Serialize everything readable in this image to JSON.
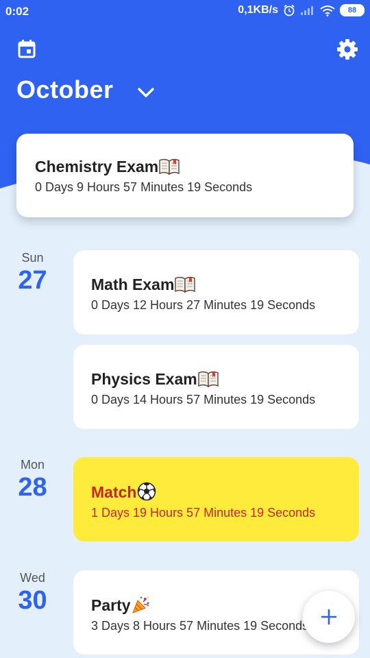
{
  "status_bar": {
    "time": "0:02",
    "net_speed": "0,1KB/s",
    "battery": "88"
  },
  "header": {
    "month": "October"
  },
  "featured": {
    "title": "Chemistry Exam",
    "emoji": "book-icon",
    "countdown": "0 Days 9 Hours 57 Minutes 19 Seconds"
  },
  "days": [
    {
      "dow": "Sun",
      "day": "27"
    },
    {
      "dow": "Mon",
      "day": "28"
    },
    {
      "dow": "Wed",
      "day": "30"
    }
  ],
  "events": [
    {
      "title": "Math Exam",
      "emoji": "book-icon",
      "countdown": "0 Days 12 Hours 27 Minutes 19 Seconds"
    },
    {
      "title": "Physics Exam",
      "emoji": "book-icon",
      "countdown": "0 Days 14 Hours 57 Minutes 19 Seconds"
    },
    {
      "title": "Match",
      "emoji": "soccer-ball-icon",
      "countdown": "1 Days 19 Hours 57 Minutes 19 Seconds",
      "highlight": "#ffeb3b"
    },
    {
      "title": "Party",
      "emoji": "party-popper-icon",
      "countdown": "3 Days 8 Hours 57 Minutes 19 Seconds"
    }
  ],
  "colors": {
    "primary": "#2f62f1",
    "background": "#e3f0fc",
    "highlight_card": "#ffeb3b",
    "highlight_text": "#c62828"
  }
}
